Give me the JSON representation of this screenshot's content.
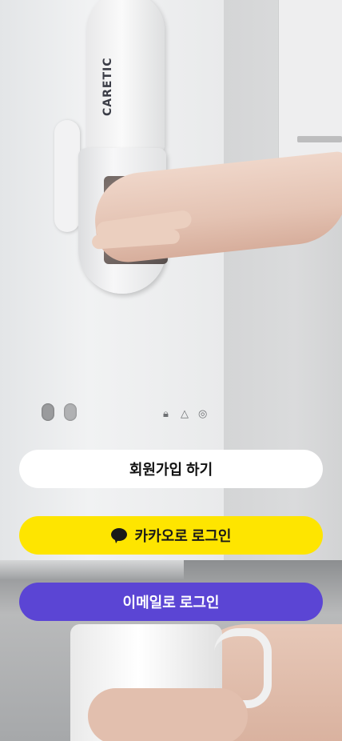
{
  "photo": {
    "product_brand": "CARETIC",
    "description_icon": "water-purifier-photo"
  },
  "actions": {
    "signup_label": "회원가입 하기",
    "kakao_label": "카카오로 로그인",
    "email_label": "이메일로 로그인"
  },
  "colors": {
    "signup_bg": "#ffffff",
    "kakao_bg": "#fee500",
    "email_bg": "#5b45d4"
  },
  "icons": {
    "kakao": "kakao-talk-bubble-icon"
  }
}
